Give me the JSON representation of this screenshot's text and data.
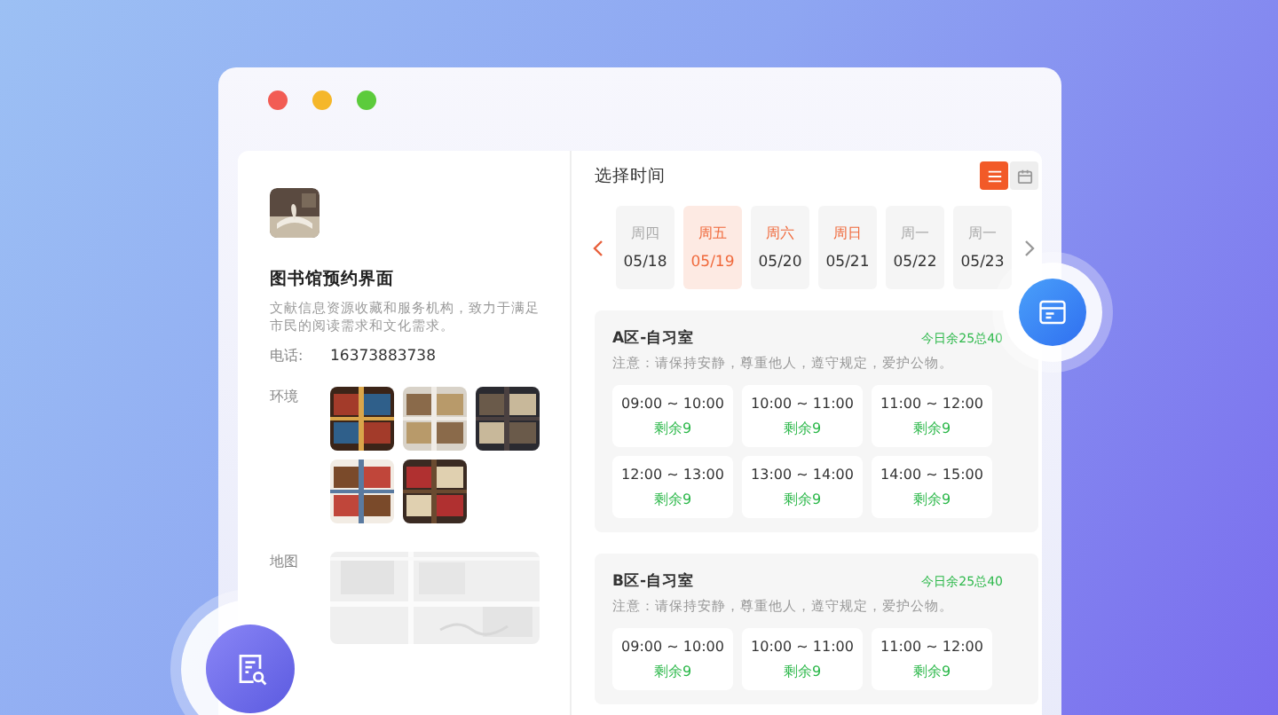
{
  "window": {
    "controls": [
      {
        "kind": "close"
      },
      {
        "kind": "minimize"
      },
      {
        "kind": "maximize"
      }
    ]
  },
  "library": {
    "name": "图书馆预约界面",
    "description": "文献信息资源收藏和服务机构，致力于满足市民的阅读需求和文化需求。",
    "phone_label": "电话:",
    "phone": "16373883738",
    "environment_label": "环境",
    "map_label": "地图"
  },
  "schedule": {
    "title": "选择时间",
    "views": [
      {
        "kind": "list",
        "selected": true
      },
      {
        "kind": "calendar",
        "selected": false
      }
    ],
    "days": [
      {
        "weekday": "周四",
        "date": "05/18",
        "selected": false,
        "weekend": false
      },
      {
        "weekday": "周五",
        "date": "05/19",
        "selected": true,
        "weekend": false
      },
      {
        "weekday": "周六",
        "date": "05/20",
        "selected": false,
        "weekend": true
      },
      {
        "weekday": "周日",
        "date": "05/21",
        "selected": false,
        "weekend": true
      },
      {
        "weekday": "周一",
        "date": "05/22",
        "selected": false,
        "weekend": false
      },
      {
        "weekday": "周一",
        "date": "05/23",
        "selected": false,
        "weekend": false
      }
    ],
    "rooms": [
      {
        "name": "A区-自习室",
        "availability": "今日余25总40",
        "notice": "注意：请保持安静，尊重他人，遵守规定，爱护公物。",
        "slots": [
          {
            "time": "09:00 ~ 10:00",
            "remaining": "剩余9"
          },
          {
            "time": "10:00 ~ 11:00",
            "remaining": "剩余9"
          },
          {
            "time": "11:00 ~ 12:00",
            "remaining": "剩余9"
          },
          {
            "time": "12:00 ~ 13:00",
            "remaining": "剩余9"
          },
          {
            "time": "13:00 ~ 14:00",
            "remaining": "剩余9"
          },
          {
            "time": "14:00 ~ 15:00",
            "remaining": "剩余9"
          }
        ]
      },
      {
        "name": "B区-自习室",
        "availability": "今日余25总40",
        "notice": "注意：请保持安静，尊重他人，遵守规定，爱护公物。",
        "slots": [
          {
            "time": "09:00 ~ 10:00",
            "remaining": "剩余9"
          },
          {
            "time": "10:00 ~ 11:00",
            "remaining": "剩余9"
          },
          {
            "time": "11:00 ~ 12:00",
            "remaining": "剩余9"
          }
        ]
      }
    ]
  }
}
